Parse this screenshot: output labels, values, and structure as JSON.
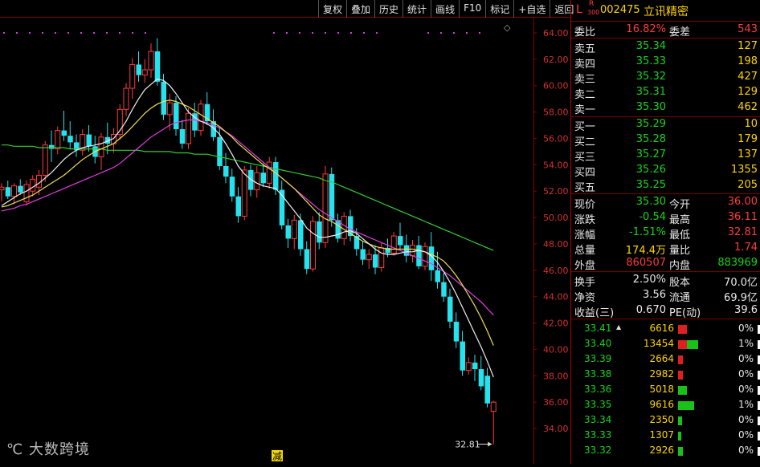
{
  "toolbar": [
    "复权",
    "叠加",
    "历史",
    "统计",
    "画线",
    "F10",
    "标记",
    "+自选",
    "返回"
  ],
  "stock": {
    "badge_l": "L",
    "badge_r": "R",
    "badge_num": "300",
    "code": "002475",
    "name": "立讯精密"
  },
  "weibi": {
    "label": "委比",
    "value": "16.82%",
    "diff_label": "委差",
    "diff": "543"
  },
  "asks": [
    {
      "label": "卖五",
      "price": "35.34",
      "vol": "127"
    },
    {
      "label": "卖四",
      "price": "35.33",
      "vol": "198"
    },
    {
      "label": "卖三",
      "price": "35.32",
      "vol": "427"
    },
    {
      "label": "卖二",
      "price": "35.31",
      "vol": "129"
    },
    {
      "label": "卖一",
      "price": "35.30",
      "vol": "462"
    }
  ],
  "bids": [
    {
      "label": "买一",
      "price": "35.29",
      "vol": "10"
    },
    {
      "label": "买二",
      "price": "35.28",
      "vol": "179"
    },
    {
      "label": "买三",
      "price": "35.27",
      "vol": "137"
    },
    {
      "label": "买四",
      "price": "35.26",
      "vol": "1355"
    },
    {
      "label": "买五",
      "price": "35.25",
      "vol": "205"
    }
  ],
  "quote": [
    {
      "l1": "现价",
      "v1": "35.30",
      "c1": "green",
      "l2": "今开",
      "v2": "36.00",
      "c2": "red"
    },
    {
      "l1": "涨跌",
      "v1": "-0.54",
      "c1": "green",
      "l2": "最高",
      "v2": "36.11",
      "c2": "red"
    },
    {
      "l1": "涨幅",
      "v1": "-1.51%",
      "c1": "green",
      "l2": "最低",
      "v2": "32.81",
      "c2": "red"
    },
    {
      "l1": "总量",
      "v1": "174.4万",
      "c1": "yel",
      "l2": "量比",
      "v2": "1.74",
      "c2": "red"
    },
    {
      "l1": "外盘",
      "v1": "860507",
      "c1": "red",
      "l2": "内盘",
      "v2": "883969",
      "c2": "green"
    }
  ],
  "fund": [
    {
      "l1": "换手",
      "v1": "2.50%",
      "l2": "股本",
      "v2": "70.0亿"
    },
    {
      "l1": "净资",
      "v1": "3.56",
      "l2": "流通",
      "v2": "69.9亿"
    },
    {
      "l1": "收益(三)",
      "v1": "0.670",
      "l2": "PE(动)",
      "v2": "39.6"
    }
  ],
  "distribution": [
    {
      "price": "33.41",
      "vol": "6616",
      "pct": "0%",
      "red": 0.12,
      "green": 0.0,
      "mark": true
    },
    {
      "price": "33.40",
      "vol": "13454",
      "pct": "1%",
      "red": 0.12,
      "green": 0.15
    },
    {
      "price": "33.39",
      "vol": "2664",
      "pct": "0%",
      "red": 0.07,
      "green": 0.0
    },
    {
      "price": "33.38",
      "vol": "2982",
      "pct": "0%",
      "red": 0.07,
      "green": 0.0
    },
    {
      "price": "33.36",
      "vol": "5018",
      "pct": "0%",
      "red": 0.0,
      "green": 0.12
    },
    {
      "price": "33.35",
      "vol": "9616",
      "pct": "1%",
      "red": 0.0,
      "green": 0.22
    },
    {
      "price": "33.34",
      "vol": "2350",
      "pct": "0%",
      "red": 0.0,
      "green": 0.06
    },
    {
      "price": "33.33",
      "vol": "1307",
      "pct": "0%",
      "red": 0.0,
      "green": 0.04
    },
    {
      "price": "33.32",
      "vol": "2926",
      "pct": "0%",
      "red": 0.0,
      "green": 0.07
    }
  ],
  "watermark": "大数跨境",
  "chart_data": {
    "type": "candlestick",
    "ylim": [
      33,
      65
    ],
    "y_ticks": [
      "64.00",
      "62.00",
      "60.00",
      "58.00",
      "56.00",
      "54.00",
      "52.00",
      "50.00",
      "48.00",
      "46.00",
      "44.00",
      "42.00",
      "40.00",
      "38.00",
      "36.00",
      "34.00"
    ],
    "low_marker": "32.81",
    "annotation": "减",
    "candles": [
      [
        52.1,
        52.6,
        51.2,
        52.3
      ],
      [
        52.3,
        52.8,
        51.4,
        51.6
      ],
      [
        51.6,
        52.6,
        51.0,
        52.4
      ],
      [
        52.4,
        52.9,
        51.7,
        51.9
      ],
      [
        51.2,
        52.8,
        50.9,
        52.5
      ],
      [
        52.0,
        53.2,
        51.6,
        52.9
      ],
      [
        52.3,
        53.6,
        51.7,
        53.2
      ],
      [
        53.2,
        55.8,
        52.7,
        55.5
      ],
      [
        55.5,
        56.6,
        54.2,
        55.2
      ],
      [
        55.2,
        56.9,
        54.8,
        56.6
      ],
      [
        56.6,
        58.1,
        55.8,
        56.2
      ],
      [
        56.2,
        57.3,
        55.2,
        55.7
      ],
      [
        55.7,
        56.3,
        54.6,
        55.1
      ],
      [
        55.1,
        56.7,
        54.7,
        56.3
      ],
      [
        56.3,
        57.0,
        55.0,
        55.4
      ],
      [
        55.4,
        56.2,
        54.1,
        54.6
      ],
      [
        54.6,
        56.4,
        53.6,
        56.1
      ],
      [
        56.1,
        57.2,
        54.8,
        55.6
      ],
      [
        55.6,
        56.8,
        54.9,
        56.3
      ],
      [
        56.3,
        58.6,
        55.9,
        58.2
      ],
      [
        58.2,
        60.2,
        57.7,
        59.8
      ],
      [
        59.8,
        62.1,
        59.0,
        61.6
      ],
      [
        61.6,
        62.6,
        60.3,
        60.8
      ],
      [
        60.8,
        62.0,
        60.2,
        61.2
      ],
      [
        61.2,
        63.2,
        60.6,
        62.6
      ],
      [
        62.6,
        63.6,
        60.0,
        60.3
      ],
      [
        60.3,
        60.9,
        57.4,
        57.8
      ],
      [
        57.8,
        59.4,
        56.6,
        58.7
      ],
      [
        58.7,
        59.2,
        56.2,
        56.7
      ],
      [
        56.7,
        57.4,
        55.2,
        55.6
      ],
      [
        55.6,
        58.3,
        55.2,
        57.9
      ],
      [
        57.9,
        58.7,
        56.1,
        56.6
      ],
      [
        56.6,
        58.9,
        56.2,
        58.6
      ],
      [
        58.6,
        59.5,
        57.0,
        57.3
      ],
      [
        57.3,
        58.2,
        55.8,
        56.1
      ],
      [
        56.1,
        56.8,
        53.6,
        53.9
      ],
      [
        53.9,
        54.9,
        52.6,
        53.1
      ],
      [
        53.1,
        53.7,
        51.2,
        51.6
      ],
      [
        51.6,
        52.3,
        49.6,
        50.1
      ],
      [
        50.1,
        53.9,
        49.8,
        53.6
      ],
      [
        53.6,
        54.0,
        51.6,
        52.1
      ],
      [
        52.1,
        53.9,
        51.5,
        53.4
      ],
      [
        53.4,
        54.1,
        52.3,
        52.6
      ],
      [
        52.6,
        54.6,
        52.2,
        54.2
      ],
      [
        54.2,
        54.6,
        51.7,
        52.1
      ],
      [
        52.1,
        52.8,
        49.1,
        49.4
      ],
      [
        49.4,
        49.9,
        47.7,
        48.4
      ],
      [
        48.4,
        50.2,
        47.6,
        49.8
      ],
      [
        49.8,
        50.3,
        47.1,
        47.6
      ],
      [
        47.6,
        48.2,
        45.7,
        46.1
      ],
      [
        46.1,
        50.1,
        45.9,
        49.7
      ],
      [
        49.7,
        50.4,
        47.6,
        48.1
      ],
      [
        48.1,
        53.9,
        47.7,
        53.3
      ],
      [
        53.3,
        53.8,
        49.3,
        49.8
      ],
      [
        49.8,
        50.3,
        48.1,
        48.4
      ],
      [
        48.4,
        50.4,
        47.9,
        50.1
      ],
      [
        50.1,
        50.6,
        48.2,
        48.6
      ],
      [
        48.6,
        49.2,
        47.1,
        47.6
      ],
      [
        47.6,
        48.2,
        46.4,
        46.8
      ],
      [
        46.8,
        47.6,
        46.1,
        47.2
      ],
      [
        47.2,
        47.9,
        45.7,
        46.2
      ],
      [
        46.2,
        48.1,
        45.9,
        47.7
      ],
      [
        47.7,
        48.4,
        47.0,
        47.3
      ],
      [
        47.3,
        48.9,
        47.1,
        48.6
      ],
      [
        48.6,
        49.6,
        47.6,
        47.9
      ],
      [
        47.9,
        48.7,
        46.6,
        47.1
      ],
      [
        47.1,
        48.3,
        46.6,
        47.9
      ],
      [
        47.9,
        48.6,
        46.1,
        46.3
      ],
      [
        46.3,
        48.1,
        46.0,
        47.8
      ],
      [
        47.8,
        48.9,
        45.2,
        46.0
      ],
      [
        46.0,
        47.4,
        44.6,
        45.1
      ],
      [
        45.1,
        45.8,
        43.6,
        44.0
      ],
      [
        44.0,
        44.6,
        41.6,
        42.1
      ],
      [
        42.1,
        42.8,
        40.1,
        40.6
      ],
      [
        40.6,
        41.4,
        38.0,
        38.4
      ],
      [
        38.4,
        39.4,
        38.1,
        39.0
      ],
      [
        39.0,
        39.6,
        37.6,
        38.5
      ],
      [
        38.5,
        39.5,
        36.9,
        37.2
      ],
      [
        38.0,
        38.6,
        35.6,
        35.9
      ],
      [
        35.3,
        36.1,
        32.8,
        36.0
      ]
    ],
    "ma_white": [
      50.9,
      51.2,
      51.5,
      51.8,
      52.0,
      52.3,
      52.6,
      53.0,
      53.4,
      53.9,
      54.4,
      54.8,
      55.1,
      55.3,
      55.4,
      55.5,
      55.6,
      55.8,
      56.0,
      56.6,
      57.3,
      58.2,
      59.0,
      59.7,
      60.1,
      60.5,
      60.4,
      60.0,
      59.4,
      58.7,
      58.0,
      57.6,
      57.3,
      57.1,
      56.8,
      56.3,
      55.6,
      54.8,
      53.9,
      53.3,
      52.9,
      52.6,
      52.4,
      52.3,
      52.2,
      51.7,
      51.1,
      50.5,
      49.9,
      49.2,
      48.8,
      48.5,
      48.5,
      48.6,
      48.7,
      48.9,
      49.0,
      48.8,
      48.4,
      48.0,
      47.6,
      47.3,
      47.2,
      47.2,
      47.3,
      47.4,
      47.4,
      47.5,
      47.4,
      47.1,
      46.6,
      45.9,
      45.1,
      44.2,
      43.2,
      42.2,
      41.2,
      40.2,
      39.1,
      37.9
    ],
    "ma_yellow": [
      50.8,
      50.9,
      51.1,
      51.3,
      51.5,
      51.7,
      52.0,
      52.3,
      52.6,
      52.9,
      53.2,
      53.6,
      54.0,
      54.4,
      54.7,
      55.0,
      55.2,
      55.4,
      55.6,
      56.0,
      56.4,
      56.9,
      57.4,
      57.9,
      58.3,
      58.6,
      58.8,
      58.9,
      58.8,
      58.6,
      58.4,
      58.1,
      57.8,
      57.5,
      57.2,
      56.9,
      56.5,
      56.1,
      55.6,
      55.2,
      54.8,
      54.4,
      54.0,
      53.7,
      53.4,
      53.0,
      52.6,
      52.2,
      51.7,
      51.2,
      50.7,
      50.2,
      49.9,
      49.7,
      49.4,
      49.1,
      48.8,
      48.5,
      48.2,
      48.0,
      47.8,
      47.7,
      47.6,
      47.6,
      47.6,
      47.6,
      47.6,
      47.5,
      47.4,
      47.2,
      47.0,
      46.7,
      46.2,
      45.6,
      44.9,
      44.1,
      43.3,
      42.4,
      41.4,
      40.3
    ],
    "ma_magenta": [
      50.5,
      50.6,
      50.7,
      50.9,
      51.0,
      51.2,
      51.4,
      51.6,
      51.8,
      52.0,
      52.2,
      52.4,
      52.6,
      52.8,
      53.0,
      53.2,
      53.4,
      53.6,
      53.8,
      54.1,
      54.5,
      54.9,
      55.3,
      55.7,
      56.1,
      56.4,
      56.7,
      57.0,
      57.2,
      57.3,
      57.4,
      57.4,
      57.3,
      57.2,
      57.0,
      56.8,
      56.5,
      56.2,
      55.8,
      55.4,
      55.0,
      54.6,
      54.2,
      53.8,
      53.4,
      53.0,
      52.6,
      52.2,
      51.8,
      51.4,
      51.0,
      50.6,
      50.3,
      50.0,
      49.7,
      49.4,
      49.1,
      48.9,
      48.7,
      48.5,
      48.3,
      48.1,
      47.9,
      47.7,
      47.5,
      47.3,
      47.1,
      46.9,
      46.7,
      46.5,
      46.2,
      45.9,
      45.6,
      45.2,
      44.8,
      44.4,
      44.0,
      43.6,
      43.1,
      42.6
    ],
    "ma_green": [
      55.5,
      55.5,
      55.4,
      55.4,
      55.4,
      55.4,
      55.3,
      55.3,
      55.3,
      55.3,
      55.3,
      55.2,
      55.2,
      55.2,
      55.2,
      55.2,
      55.2,
      55.1,
      55.1,
      55.1,
      55.1,
      55.1,
      55.1,
      55.0,
      55.0,
      55.0,
      55.0,
      55.0,
      54.9,
      54.9,
      54.9,
      54.8,
      54.8,
      54.8,
      54.7,
      54.6,
      54.5,
      54.4,
      54.3,
      54.2,
      54.1,
      54.0,
      53.9,
      53.8,
      53.7,
      53.6,
      53.5,
      53.4,
      53.3,
      53.2,
      53.1,
      53.0,
      52.8,
      52.7,
      52.5,
      52.3,
      52.1,
      51.9,
      51.7,
      51.5,
      51.3,
      51.1,
      50.9,
      50.7,
      50.5,
      50.3,
      50.1,
      49.9,
      49.7,
      49.5,
      49.3,
      49.1,
      48.9,
      48.7,
      48.5,
      48.3,
      48.1,
      47.9,
      47.7,
      47.5
    ]
  }
}
